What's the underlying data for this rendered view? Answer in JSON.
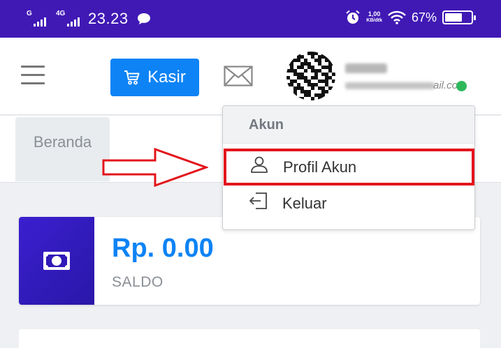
{
  "status_bar": {
    "network_1": "G",
    "network_2": "4G",
    "time": "23.23",
    "speed_value": "1,00",
    "speed_unit": "KB/dtk",
    "battery_percent": "67%",
    "battery_level": 0.67,
    "icons": [
      "signal-icon",
      "chat-bubble-icon",
      "alarm-icon",
      "wifi-icon",
      "battery-icon"
    ]
  },
  "header": {
    "menu_icon": "hamburger-icon",
    "kasir_button_label": "Kasir",
    "kasir_icon": "cart-icon",
    "kasir_color": "#0d83f5",
    "mail_icon": "mail-icon",
    "email_suffix": "ail.com",
    "online_color": "#2eb85c"
  },
  "tabs": {
    "beranda_label": "Beranda"
  },
  "dropdown": {
    "header_label": "Akun",
    "items": [
      {
        "label": "Profil Akun",
        "icon": "user-icon"
      },
      {
        "label": "Keluar",
        "icon": "logout-icon"
      }
    ],
    "highlight_color": "#e3151c"
  },
  "balance_card": {
    "amount": "Rp. 0.00",
    "label": "SALDO",
    "icon": "money-icon",
    "amount_color": "#0d83f5"
  },
  "colors": {
    "status_bar": "#4019b5",
    "card_icon_bg": "#2a17a8"
  }
}
